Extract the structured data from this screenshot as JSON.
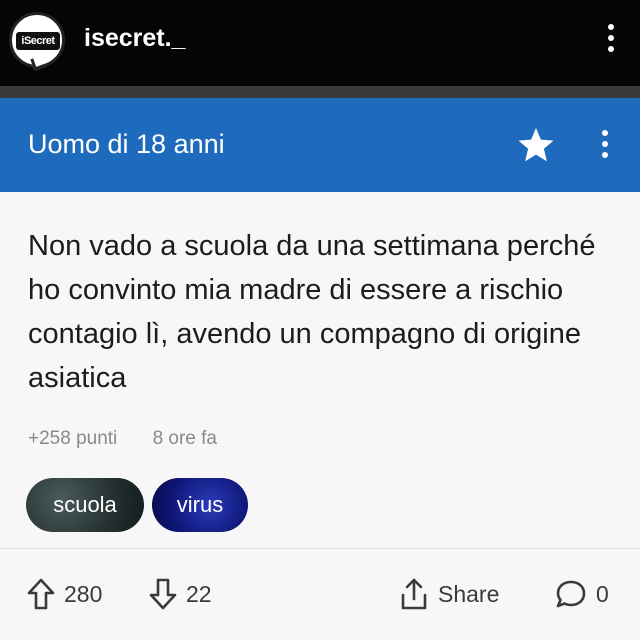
{
  "header": {
    "logo_text": "iSecret",
    "account_name": "isecret._"
  },
  "post": {
    "author": "Uomo di 18 anni",
    "text": "Non vado a scuola da una settimana perché ho convinto mia madre di essere a rischio contagio lì, avendo un compagno di origine asiatica",
    "points": "+258 punti",
    "time": "8 ore fa",
    "tags": [
      "scuola",
      "virus"
    ]
  },
  "actions": {
    "upvotes": "280",
    "downvotes": "22",
    "share_label": "Share",
    "comments": "0"
  },
  "icons": {
    "avatar": "secret-logo-icon",
    "top_menu": "more-vertical-icon",
    "favorite": "star-icon",
    "post_menu": "more-vertical-icon",
    "upvote": "arrow-up-icon",
    "downvote": "arrow-down-icon",
    "share": "share-icon",
    "comment": "comment-bubble-icon"
  },
  "colors": {
    "header_bg": "#050505",
    "author_bar": "#1e6bbd",
    "content_bg": "#f7f7f7",
    "text": "#1c1c1c",
    "meta_text": "#8a8a8a"
  }
}
